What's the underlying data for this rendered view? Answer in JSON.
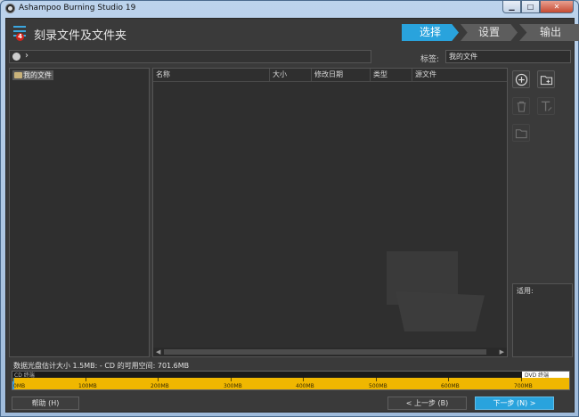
{
  "window": {
    "title": "Ashampoo Burning Studio 19",
    "minimize": "▁",
    "maximize": "□",
    "close": "✕"
  },
  "header": {
    "title": "刻录文件及文件夹",
    "badge": "4",
    "steps": [
      {
        "label": "选择",
        "active": true
      },
      {
        "label": "设置",
        "active": false
      },
      {
        "label": "输出",
        "active": false
      }
    ]
  },
  "toolbar": {
    "path_chevron": "›",
    "label_caption": "标签:",
    "label_value": "我的文件"
  },
  "tree": {
    "root": "我的文件"
  },
  "filelist": {
    "columns": [
      "名称",
      "大小",
      "修改日期",
      "类型",
      "源文件"
    ]
  },
  "usage": {
    "label": "适用:"
  },
  "capacity": {
    "summary": "数据光盘估计大小 1.5MB: - CD 的可用空间: 701.6MB",
    "cd_caption": "CD 终端",
    "dvd_caption": "DVD 终端",
    "used_fraction": 0.002,
    "ticks": [
      "0MB",
      "100MB",
      "200MB",
      "300MB",
      "400MB",
      "500MB",
      "600MB",
      "700MB"
    ]
  },
  "footer": {
    "help": "帮助 (H)",
    "back": "< 上一步 (B)",
    "next": "下一步 (N) >"
  },
  "colors": {
    "accent": "#29a3dd",
    "capacity": "#f0b700",
    "badge": "#d0231c"
  }
}
